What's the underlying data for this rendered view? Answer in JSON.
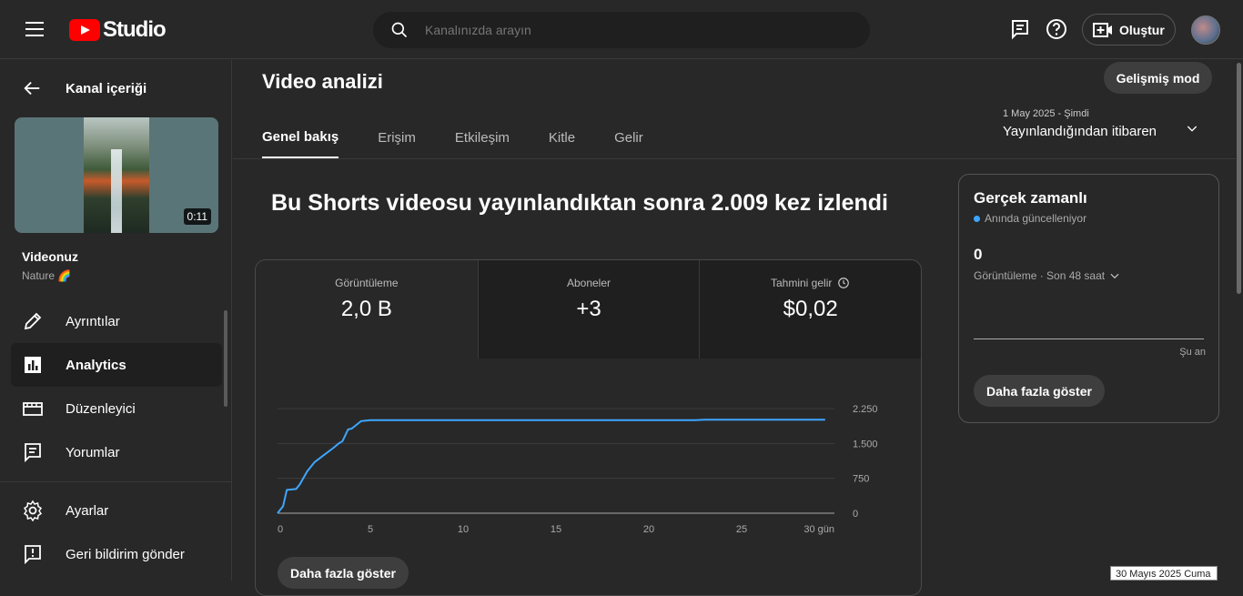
{
  "header": {
    "logo_text": "Studio",
    "search_placeholder": "Kanalınızda arayın",
    "create_label": "Oluştur"
  },
  "sidebar": {
    "back_label": "Kanal içeriği",
    "video": {
      "duration": "0:11",
      "title": "Videonuz",
      "subtitle": "Nature 🌈"
    },
    "items": [
      {
        "label": "Ayrıntılar",
        "icon": "pencil-icon"
      },
      {
        "label": "Analytics",
        "icon": "analytics-icon",
        "active": true
      },
      {
        "label": "Düzenleyici",
        "icon": "editor-icon"
      },
      {
        "label": "Yorumlar",
        "icon": "comments-icon"
      }
    ],
    "bottom_items": [
      {
        "label": "Ayarlar",
        "icon": "gear-icon"
      },
      {
        "label": "Geri bildirim gönder",
        "icon": "feedback-icon"
      }
    ]
  },
  "main": {
    "title": "Video analizi",
    "advanced_mode": "Gelişmiş mod",
    "tabs": [
      "Genel bakış",
      "Erişim",
      "Etkileşim",
      "Kitle",
      "Gelir"
    ],
    "date_range": {
      "range": "1 May 2025 - Şimdi",
      "label": "Yayınlandığından itibaren"
    },
    "headline": "Bu Shorts videosu yayınlandıktan sonra 2.009 kez izlendi",
    "metrics": [
      {
        "label": "Görüntüleme",
        "value": "2,0 B"
      },
      {
        "label": "Aboneler",
        "value": "+3"
      },
      {
        "label": "Tahmini gelir",
        "value": "$0,02"
      }
    ],
    "show_more": "Daha fazla göster"
  },
  "realtime": {
    "title": "Gerçek zamanlı",
    "subtitle": "Anında güncelleniyor",
    "count": "0",
    "meta": "Görüntüleme · Son 48 saat",
    "now_label": "Şu an",
    "show_more": "Daha fazla göster"
  },
  "tooltip": "30 Mayıs 2025 Cuma",
  "colors": {
    "accent": "#3ea6ff",
    "brand": "#ff0000",
    "line": "#3ea6ff"
  },
  "chart_data": {
    "type": "line",
    "series": [
      {
        "x": [
          0,
          0.3,
          0.5,
          1.0,
          1.2,
          1.6,
          2.0,
          2.5,
          3.0,
          3.3,
          3.5,
          3.8,
          4.0,
          4.5,
          5.0,
          10,
          15,
          20,
          22.5,
          23,
          25,
          29.5
        ],
        "values": [
          0,
          150,
          500,
          520,
          620,
          900,
          1100,
          1250,
          1400,
          1500,
          1550,
          1800,
          1820,
          1980,
          2000,
          2000,
          2000,
          2000,
          2000,
          2009,
          2009,
          2009
        ]
      }
    ],
    "x_ticks": [
      "0",
      "5",
      "10",
      "15",
      "20",
      "25",
      "30 gün"
    ],
    "x_tick_values": [
      0,
      5,
      10,
      15,
      20,
      25,
      30
    ],
    "y_ticks": [
      "0",
      "750",
      "1.500",
      "2.250"
    ],
    "y_tick_values": [
      0,
      750,
      1500,
      2250
    ],
    "xlim": [
      0,
      30
    ],
    "ylim": [
      0,
      2250
    ],
    "grid": true
  }
}
